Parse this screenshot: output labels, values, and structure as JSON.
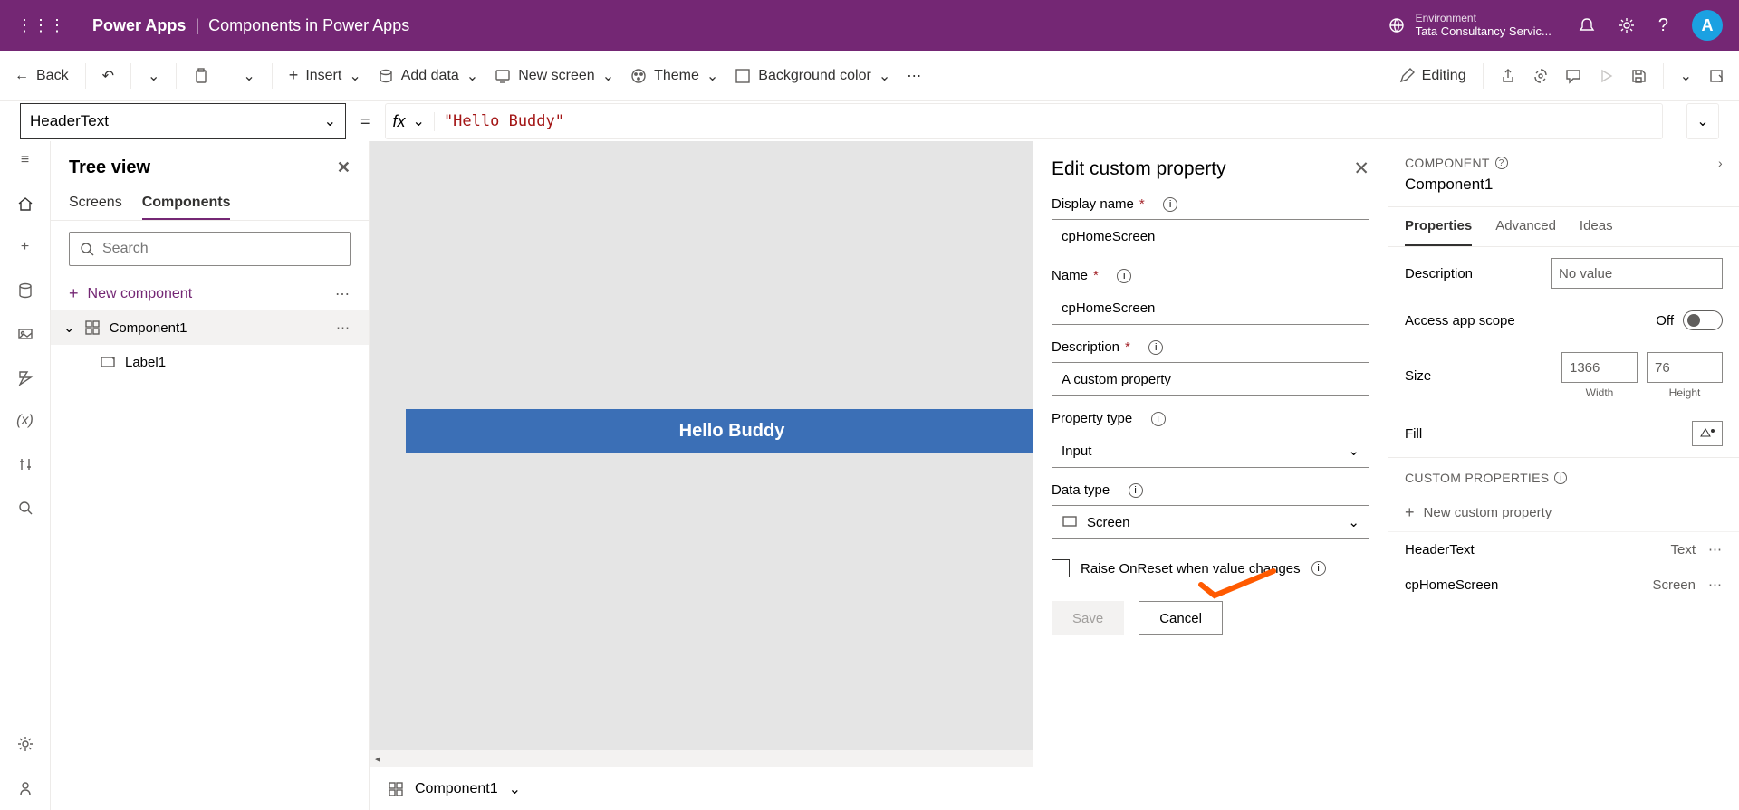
{
  "header": {
    "app_name": "Power Apps",
    "separator": "|",
    "file_name": "Components in Power Apps",
    "environment_label": "Environment",
    "environment_value": "Tata Consultancy Servic...",
    "avatar_initial": "A"
  },
  "ribbon": {
    "back": "Back",
    "insert": "Insert",
    "add_data": "Add data",
    "new_screen": "New screen",
    "theme": "Theme",
    "background_color": "Background color",
    "editing": "Editing"
  },
  "formula": {
    "property": "HeaderText",
    "fx": "fx",
    "value": "\"Hello Buddy\""
  },
  "tree": {
    "title": "Tree view",
    "tabs": {
      "screens": "Screens",
      "components": "Components"
    },
    "search_placeholder": "Search",
    "new_component": "New component",
    "items": [
      {
        "name": "Component1",
        "children": [
          {
            "name": "Label1"
          }
        ]
      }
    ]
  },
  "canvas": {
    "label_text": "Hello Buddy",
    "breadcrumb": "Component1"
  },
  "edit_panel": {
    "title": "Edit custom property",
    "display_name_label": "Display name",
    "display_name_value": "cpHomeScreen",
    "name_label": "Name",
    "name_value": "cpHomeScreen",
    "description_label": "Description",
    "description_value": "A custom property",
    "property_type_label": "Property type",
    "property_type_value": "Input",
    "data_type_label": "Data type",
    "data_type_value": "Screen",
    "checkbox_label": "Raise OnReset when value changes",
    "save": "Save",
    "cancel": "Cancel"
  },
  "prop_panel": {
    "head": "COMPONENT",
    "name": "Component1",
    "tabs": {
      "properties": "Properties",
      "advanced": "Advanced",
      "ideas": "Ideas"
    },
    "description_label": "Description",
    "description_placeholder": "No value",
    "access_scope_label": "Access app scope",
    "access_scope_value": "Off",
    "size_label": "Size",
    "width_value": "1366",
    "width_label": "Width",
    "height_value": "76",
    "height_label": "Height",
    "fill_label": "Fill",
    "custom_properties_head": "CUSTOM PROPERTIES",
    "new_custom_property": "New custom property",
    "custom_props": [
      {
        "name": "HeaderText",
        "type": "Text"
      },
      {
        "name": "cpHomeScreen",
        "type": "Screen"
      }
    ]
  }
}
